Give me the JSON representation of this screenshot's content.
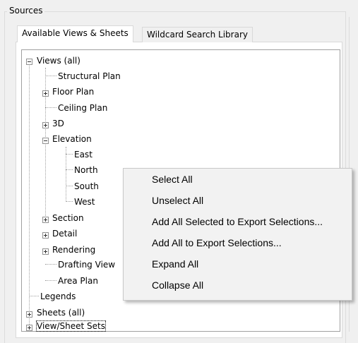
{
  "group": {
    "title": "Sources"
  },
  "tabs": [
    {
      "label": "Available Views & Sheets",
      "active": true
    },
    {
      "label": "Wildcard Search Library",
      "active": false
    }
  ],
  "tree": {
    "root": "Views (all)",
    "items": {
      "structural_plan": "Structural Plan",
      "floor_plan": "Floor Plan",
      "ceiling_plan": "Ceiling Plan",
      "three_d": "3D",
      "elevation": "Elevation",
      "east": "East",
      "north": "North",
      "south": "South",
      "west": "West",
      "section": "Section",
      "detail": "Detail",
      "rendering": "Rendering",
      "drafting_view": "Drafting View",
      "area_plan": "Area Plan",
      "legends": "Legends",
      "sheets_all": "Sheets (all)",
      "view_sheet_sets": "View/Sheet Sets"
    }
  },
  "context_menu": {
    "items": [
      "Select All",
      "Unselect All",
      "Add All Selected to Export Selections...",
      "Add All to Export Selections...",
      "Expand All",
      "Collapse All"
    ]
  }
}
